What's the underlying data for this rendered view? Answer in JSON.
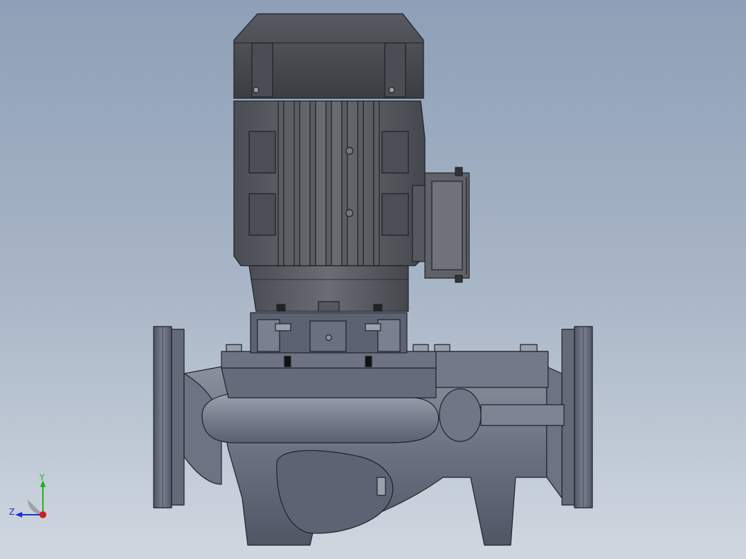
{
  "viewport": {
    "background_top": "#8ea0b7",
    "background_bottom": "#cfd7e0"
  },
  "model": {
    "body_color": "#5f6675",
    "motor_color": "#3c3f45",
    "edge_color": "#1e2128"
  },
  "triad": {
    "y_label": "Y",
    "z_label": "Z",
    "y_color": "#1fb01f",
    "z_color": "#1f2fd0",
    "x_color": "#d01f1f"
  }
}
